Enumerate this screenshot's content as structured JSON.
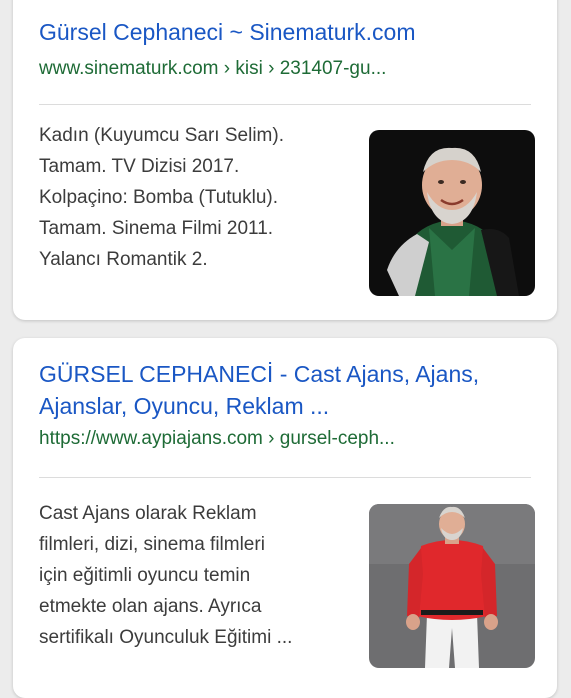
{
  "results": [
    {
      "title": "Gürsel Cephaneci ~ Sinematurk.com",
      "url": "www.sinematurk.com › kisi › 231407-gu...",
      "snippet_lines": [
        "Kadın (Kuyumcu Sarı Selim).",
        "Tamam. TV Dizisi 2017.",
        "Kolpaçino: Bomba (Tutuklu).",
        "Tamam. Sinema Filmi 2011.",
        "Yalancı Romantik 2."
      ],
      "thumbnail_icon": "person-photo-green-shirt-icon"
    },
    {
      "title_lines": [
        "GÜRSEL CEPHANECİ - Cast Ajans, Ajans,",
        "Ajanslar, Oyuncu, Reklam ..."
      ],
      "url": "https://www.aypiajans.com › gursel-ceph...",
      "snippet_lines": [
        "Cast Ajans olarak Reklam",
        "filmleri, dizi, sinema filmleri",
        "için eğitimli oyuncu temin",
        "etmekte olan ajans. Ayrıca",
        "sertifikalı Oyunculuk Eğitimi ..."
      ],
      "thumbnail_icon": "person-photo-red-shirt-icon"
    }
  ],
  "colors": {
    "title": "#1a57c4",
    "url": "#1e6b36",
    "snippet": "#3c3c3c",
    "background": "#ececec"
  }
}
